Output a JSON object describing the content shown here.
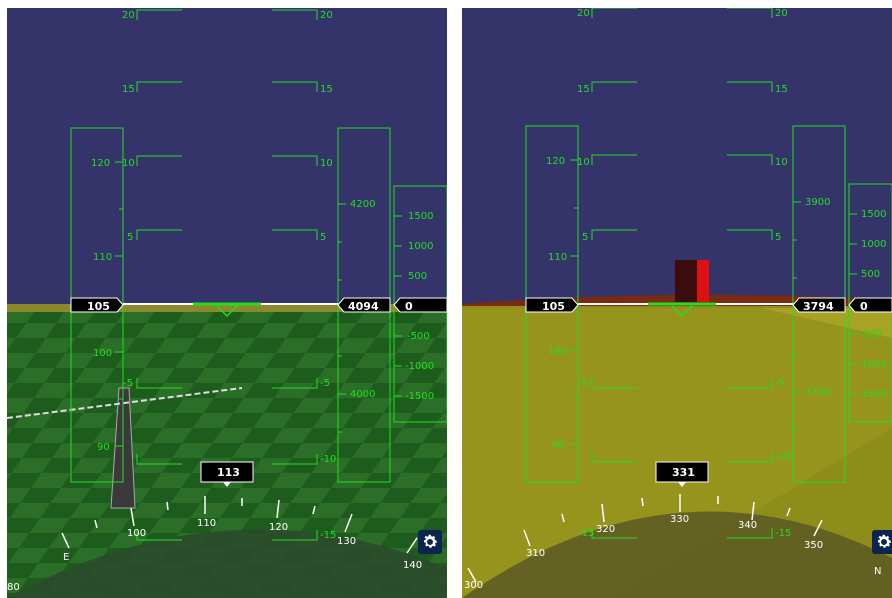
{
  "colors": {
    "sky": "#34346a",
    "hud": "#22dd22",
    "ground_left": "#1f5a1f",
    "ground_right": "#8f8d1a"
  },
  "panels": [
    {
      "id": "left",
      "speed": "105",
      "altitude": "4094",
      "vsi": "0",
      "heading": "113",
      "pitch_top": [
        "20",
        "15",
        "10",
        "5"
      ],
      "pitch_bottom": [
        "-5",
        "-10",
        "-15"
      ],
      "speed_ticks": [
        "120",
        "110",
        "100",
        "90"
      ],
      "alt_ticks": [
        "4200",
        "4000"
      ],
      "vsi_ticks": [
        "1500",
        "1000",
        "500",
        "-500",
        "-1000",
        "-1500"
      ],
      "compass": [
        "E",
        "100",
        "110",
        "120",
        "130",
        "140",
        "80"
      ]
    },
    {
      "id": "right",
      "speed": "105",
      "altitude": "3794",
      "vsi": "0",
      "heading": "331",
      "pitch_top": [
        "20",
        "15",
        "10",
        "5"
      ],
      "pitch_bottom": [
        "-5",
        "-10",
        "-15"
      ],
      "speed_ticks": [
        "120",
        "110",
        "100",
        "90"
      ],
      "alt_ticks": [
        "3900",
        "3700"
      ],
      "vsi_ticks": [
        "1500",
        "1000",
        "500",
        "-500",
        "-1000",
        "-1500"
      ],
      "compass": [
        "300",
        "310",
        "320",
        "330",
        "340",
        "350",
        "N"
      ]
    }
  ],
  "icons": {
    "settings": "gear-icon"
  }
}
